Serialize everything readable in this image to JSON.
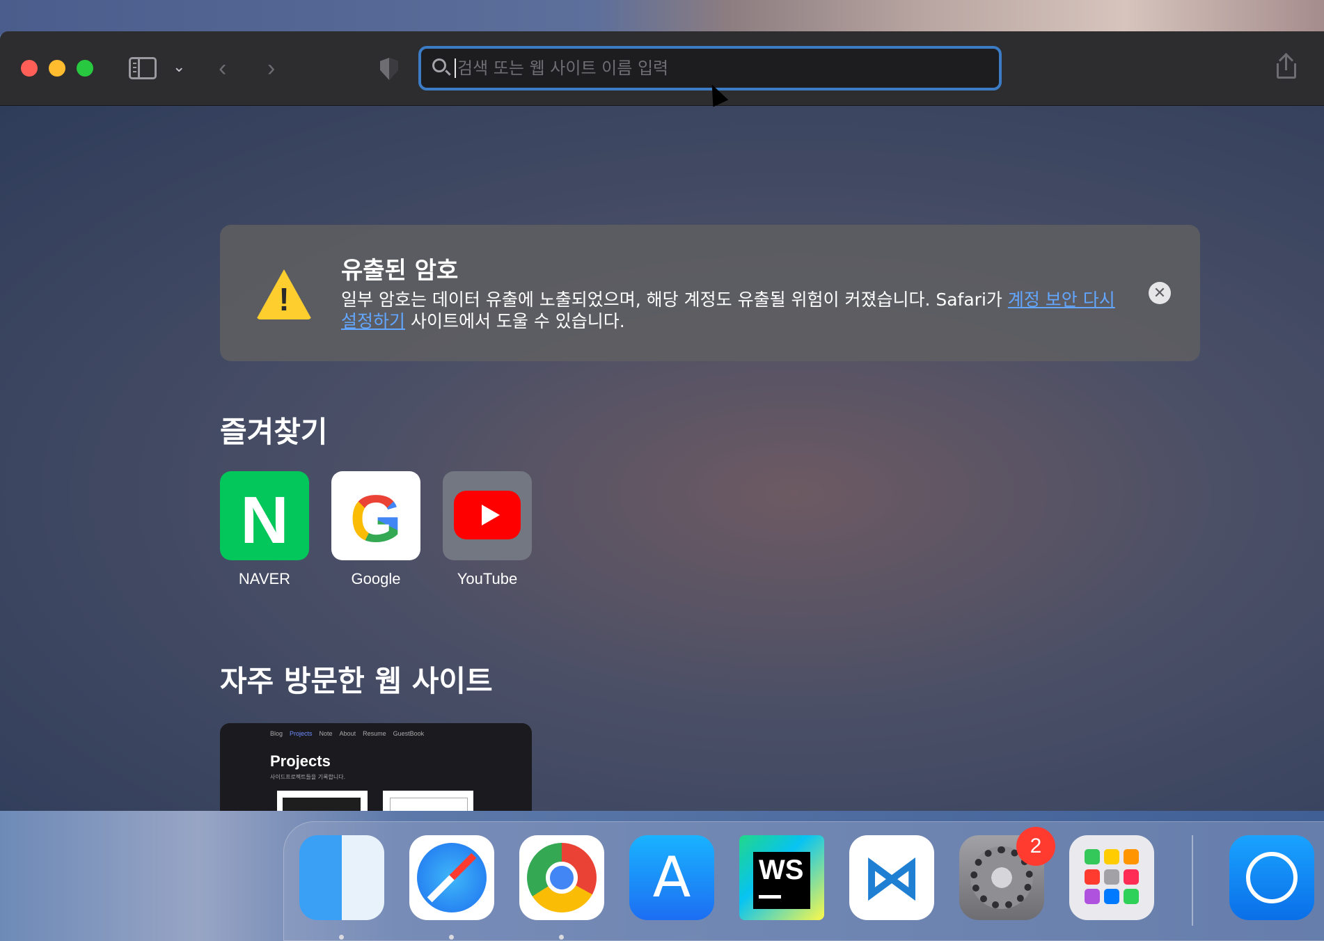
{
  "toolbar": {
    "address_placeholder": "검색 또는 웹 사이트 이름 입력"
  },
  "alert": {
    "title": "유출된 암호",
    "body_before": "일부 암호는 데이터 유출에 노출되었으며, 해당 계정도 유출될 위험이 커졌습니다. Safari가 ",
    "link": "계정 보안 다시 설정하기",
    "body_after": " 사이트에서 도울 수 있습니다."
  },
  "favorites": {
    "title": "즐겨찾기",
    "items": [
      {
        "label": "NAVER",
        "icon": "naver-icon"
      },
      {
        "label": "Google",
        "icon": "google-icon"
      },
      {
        "label": "YouTube",
        "icon": "youtube-icon"
      }
    ]
  },
  "frequently_visited": {
    "title": "자주 방문한 웹 사이트",
    "thumbnail": {
      "nav": [
        "Blog",
        "Projects",
        "Note",
        "About",
        "Resume",
        "GuestBook"
      ],
      "heading": "Projects",
      "subheading": "사이드프로젝트들을 기록합니다."
    }
  },
  "dock": {
    "apps": [
      "Finder",
      "Safari",
      "Google Chrome",
      "App Store",
      "WebStorm",
      "Visual Studio Code",
      "System Preferences",
      "Launchpad"
    ],
    "settings_badge": "2"
  },
  "icons": {
    "naver_letter": "N",
    "google_letter": "G",
    "webstorm_letters": "WS",
    "close_glyph": "✕",
    "warning_glyph": "!"
  }
}
